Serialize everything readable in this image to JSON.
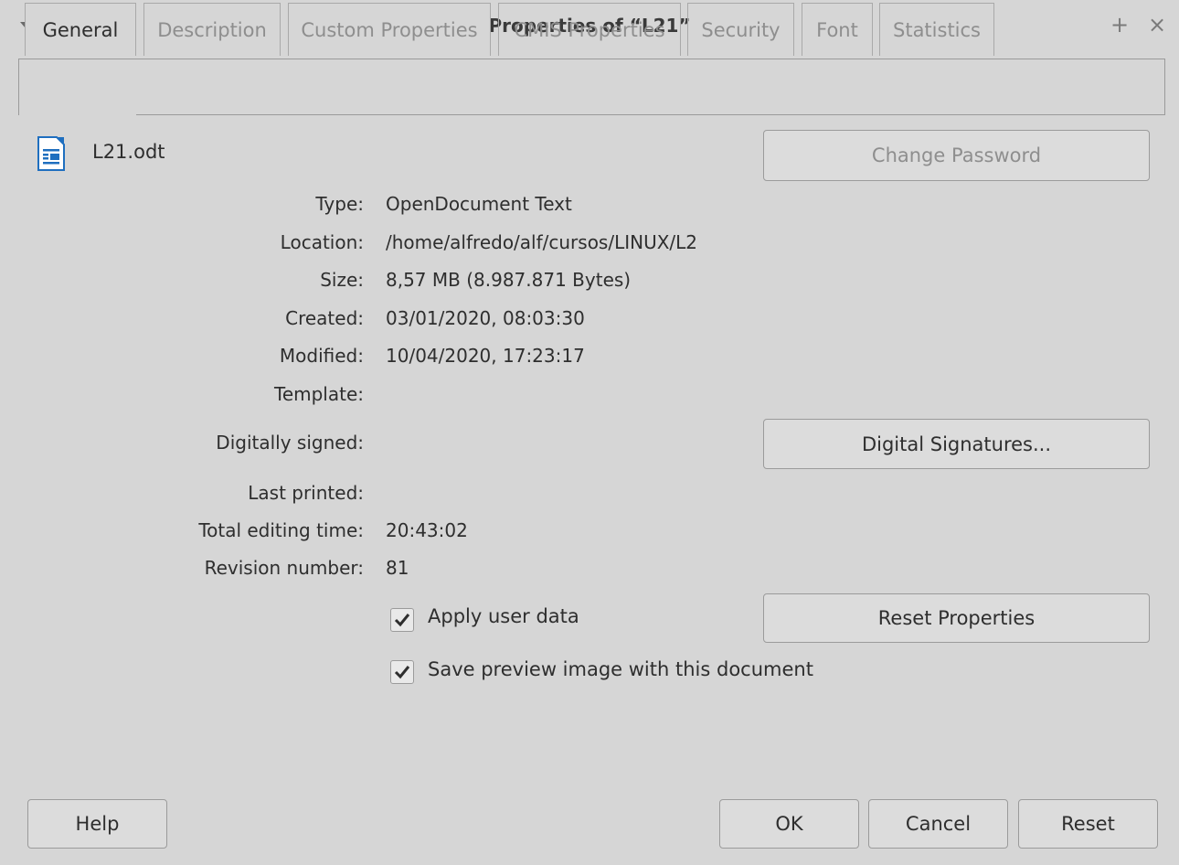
{
  "window": {
    "title": "Properties of “L21”",
    "menu_icon": "chevron-down-icon",
    "maximize_glyph": "+",
    "close_glyph": "×"
  },
  "tabs": [
    {
      "label": "General",
      "active": true
    },
    {
      "label": "Description",
      "active": false
    },
    {
      "label": "Custom Properties",
      "active": false
    },
    {
      "label": "CMIS Properties",
      "active": false
    },
    {
      "label": "Security",
      "active": false
    },
    {
      "label": "Font",
      "active": false
    },
    {
      "label": "Statistics",
      "active": false
    }
  ],
  "document": {
    "filename": "L21.odt",
    "icon": "writer-document-icon"
  },
  "properties": {
    "type_label": "Type:",
    "type_value": "OpenDocument Text",
    "location_label": "Location:",
    "location_value": "/home/alfredo/alf/cursos/LINUX/L2",
    "size_label": "Size:",
    "size_value": "8,57 MB (8.987.871 Bytes)",
    "created_label": "Created:",
    "created_value": "03/01/2020, 08:03:30",
    "modified_label": "Modified:",
    "modified_value": "10/04/2020, 17:23:17",
    "template_label": "Template:",
    "template_value": "",
    "signed_label": "Digitally signed:",
    "signed_value": "",
    "printed_label": "Last printed:",
    "printed_value": "",
    "editing_label": "Total editing time:",
    "editing_value": "20:43:02",
    "revision_label": "Revision number:",
    "revision_value": "81"
  },
  "buttons": {
    "change_password": "Change Password",
    "digital_signatures": "Digital Signatures...",
    "reset_properties": "Reset Properties",
    "help": "Help",
    "ok": "OK",
    "cancel": "Cancel",
    "reset": "Reset"
  },
  "checkboxes": {
    "apply_user_data": {
      "label": "Apply user data",
      "checked": true
    },
    "save_preview": {
      "label": "Save preview image with this document",
      "checked": true
    }
  },
  "colors": {
    "background": "#d6d6d6",
    "text": "#2e2e2e",
    "disabled_text": "#8e8e8e",
    "border": "#9b9b9b",
    "icon_blue": "#1f6fbf"
  }
}
